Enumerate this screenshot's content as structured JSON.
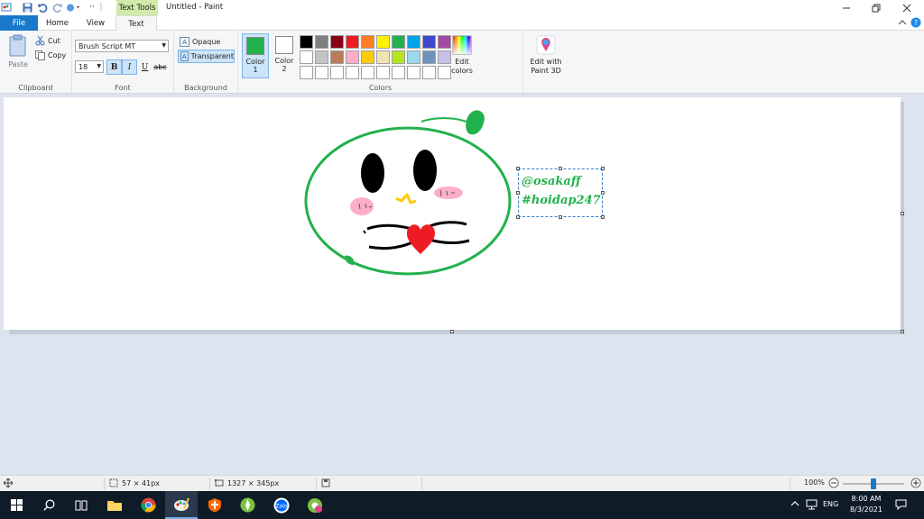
{
  "window": {
    "title": "Untitled - Paint",
    "context_tab_group": "Text Tools"
  },
  "tabs": [
    {
      "label": "File"
    },
    {
      "label": "Home"
    },
    {
      "label": "View"
    },
    {
      "label": "Text"
    }
  ],
  "clipboard": {
    "paste_label": "Paste",
    "cut_label": "Cut",
    "copy_label": "Copy",
    "group_label": "Clipboard"
  },
  "font": {
    "family": "Brush Script MT",
    "size": "18",
    "bold_label": "B",
    "italic_label": "I",
    "underline_label": "U",
    "strike_label": "abc",
    "group_label": "Font",
    "bold_active": true,
    "italic_active": true
  },
  "background": {
    "opaque_label": "Opaque",
    "transparent_label": "Transparent",
    "group_label": "Background",
    "selected": "transparent"
  },
  "colors": {
    "color1_label": "Color",
    "color1_num": "1",
    "color1_value": "#22b14c",
    "color2_label": "Color",
    "color2_num": "2",
    "color2_value": "#ffffff",
    "edit_colors_line1": "Edit",
    "edit_colors_line2": "colors",
    "paint3d_line1": "Edit with",
    "paint3d_line2": "Paint 3D",
    "group_label": "Colors",
    "palette": [
      "#000000",
      "#7f7f7f",
      "#880015",
      "#ed1c24",
      "#ff7f27",
      "#fff200",
      "#22b14c",
      "#00a2e8",
      "#3f48cc",
      "#a349a4",
      "#ffffff",
      "#c3c3c3",
      "#b97a57",
      "#ffaec9",
      "#ffc90e",
      "#efe4b0",
      "#b5e61d",
      "#99d9ea",
      "#7092be",
      "#c8bfe7",
      "#ffffff",
      "#ffffff",
      "#ffffff",
      "#ffffff",
      "#ffffff",
      "#ffffff",
      "#ffffff",
      "#ffffff",
      "#ffffff",
      "#ffffff"
    ]
  },
  "canvas_text": {
    "line1": "@osakaff",
    "line2": "#hoidap247"
  },
  "status": {
    "selection_size": "57 × 41px",
    "canvas_size": "1327 × 345px",
    "zoom": "100%",
    "zoom_fraction": 0.5
  },
  "taskbar": {
    "lang": "ENG",
    "time": "8:00 AM",
    "date": "8/3/2021"
  }
}
